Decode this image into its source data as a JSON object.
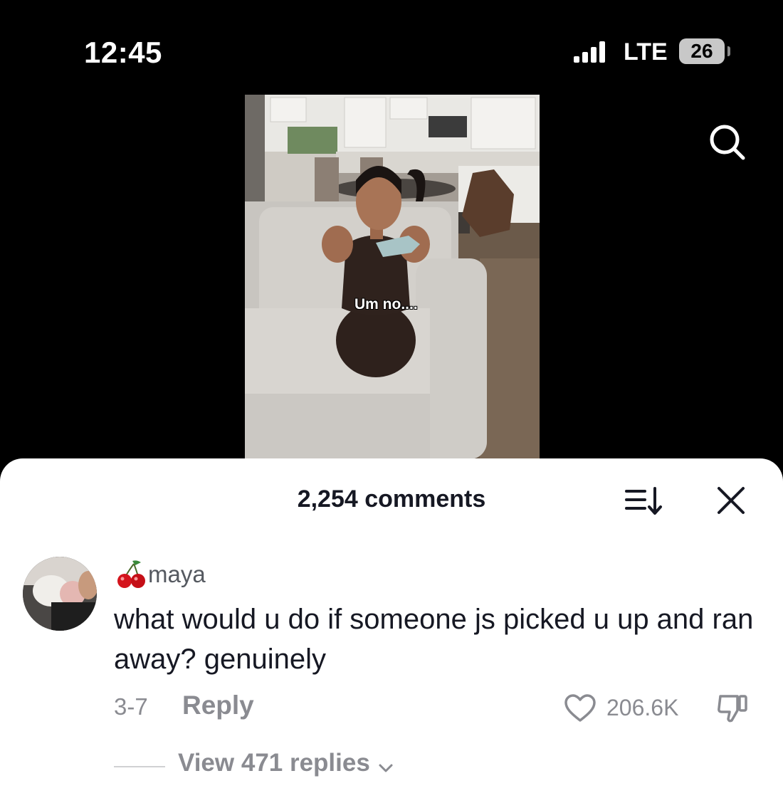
{
  "status_bar": {
    "time": "12:45",
    "network": "LTE",
    "battery": "26"
  },
  "video": {
    "caption": "Um no...."
  },
  "comments_sheet": {
    "count_label": "2,254 comments",
    "comment": {
      "username": "maya",
      "text": "what would u do if someone js picked u up and ran away? genuinely",
      "date": "3-7",
      "reply_label": "Reply",
      "like_count": "206.6K",
      "view_replies_label": "View 471 replies"
    }
  },
  "icons": [
    "signal-bars-icon",
    "battery-icon",
    "search-icon",
    "sort-icon",
    "close-icon",
    "cherry-icon",
    "heart-icon",
    "dislike-icon",
    "chevron-down-icon"
  ],
  "colors": {
    "background": "#000000",
    "sheet": "#ffffff",
    "primary_text": "#161823",
    "secondary_text": "#8a8b91"
  }
}
